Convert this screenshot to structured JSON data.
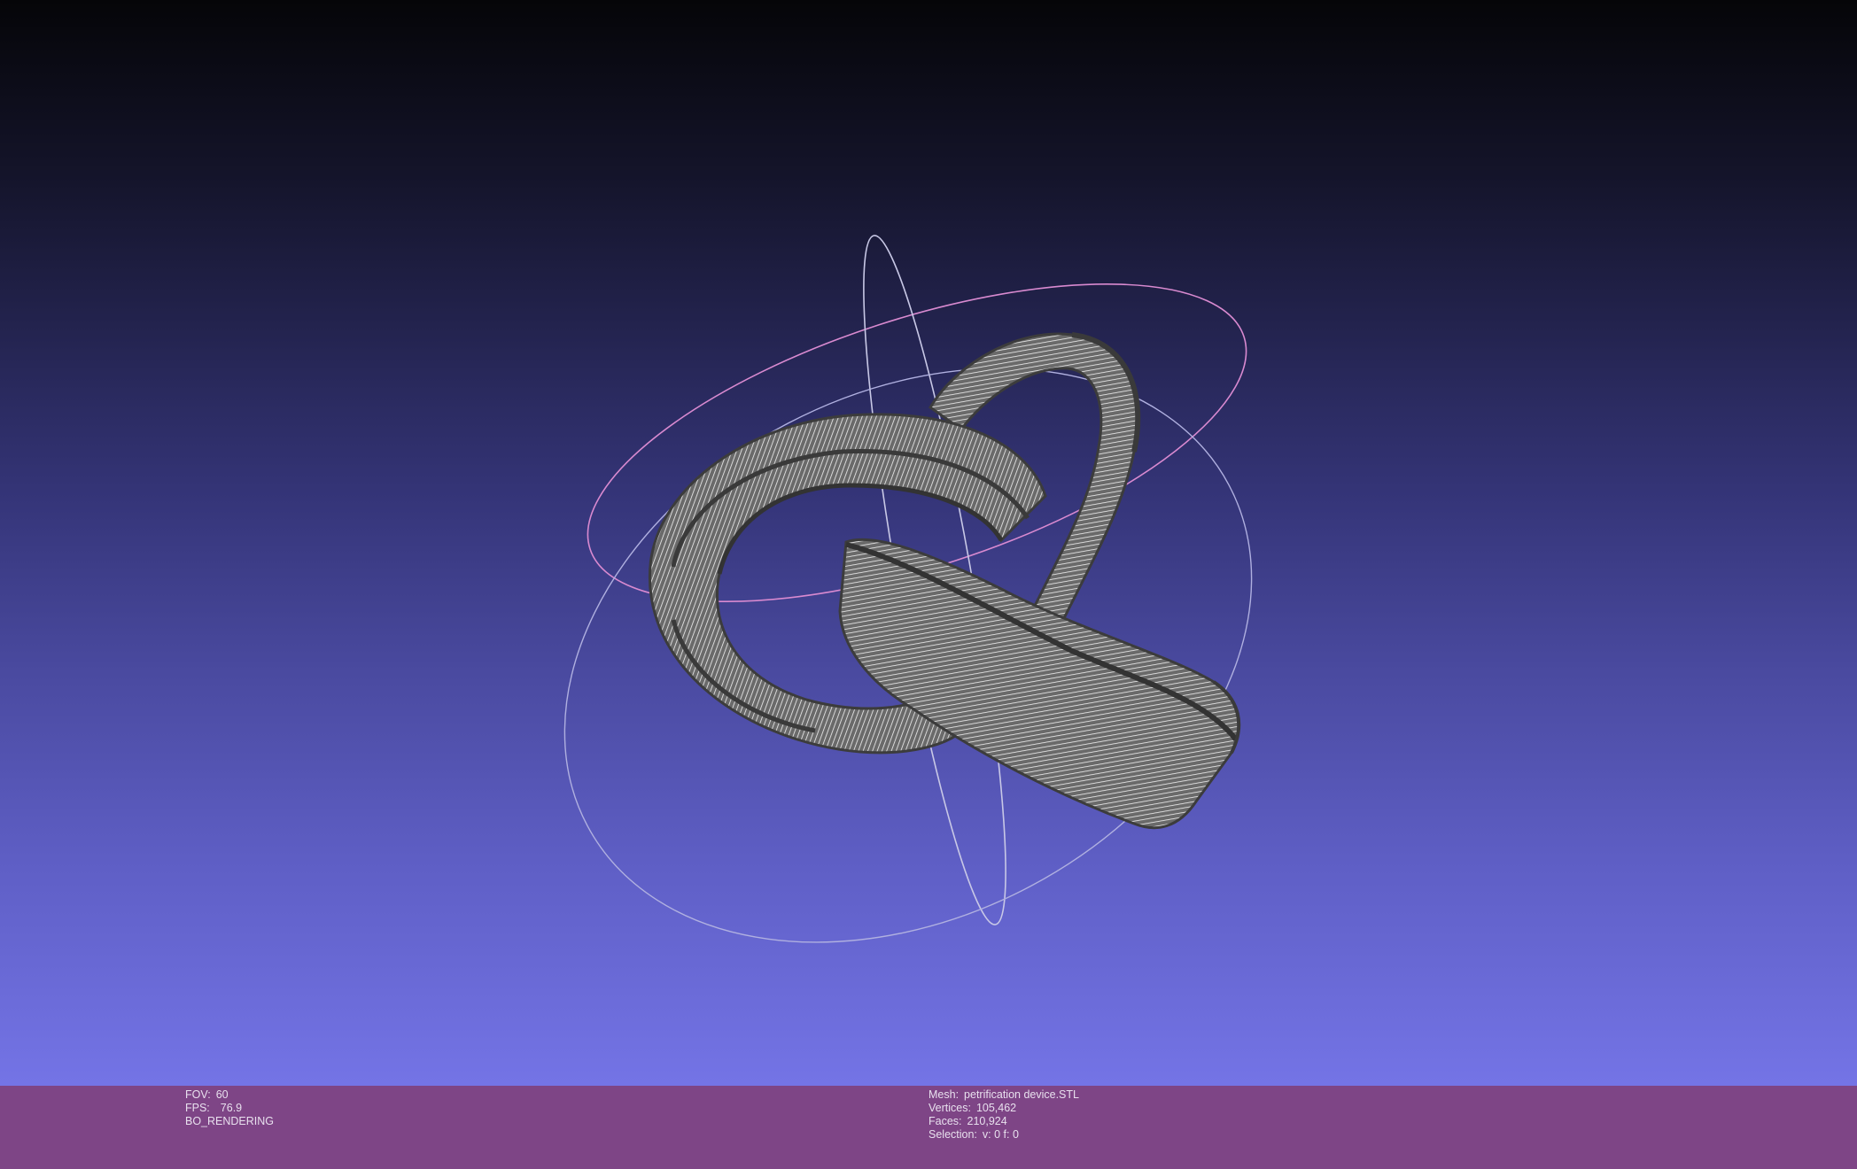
{
  "viewer": {
    "background_top_color": "#050508",
    "background_bottom_color": "#7474e6",
    "mesh_color": "#6a6a6a",
    "wire_color": "#f2f2f2",
    "trackball_colors": [
      "#d98ad0",
      "#c8c8e6",
      "#b0b0e0"
    ]
  },
  "info_bar": {
    "background_color": "#7e4586",
    "render": {
      "fov_label": "FOV:",
      "fov_value": "60",
      "fps_label": "FPS:",
      "fps_value": "76.9",
      "mode": "BO_RENDERING"
    },
    "mesh": {
      "mesh_label": "Mesh:",
      "mesh_name": "petrification device.STL",
      "vertices_label": "Vertices:",
      "vertices_value": "105,462",
      "faces_label": "Faces:",
      "faces_value": "210,924",
      "selection_label": "Selection:",
      "selection_value": "v: 0 f: 0"
    }
  }
}
